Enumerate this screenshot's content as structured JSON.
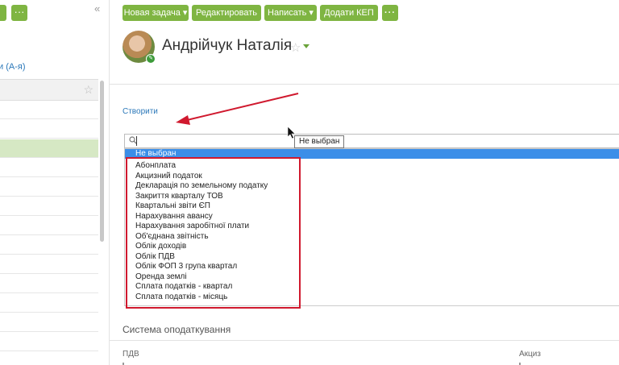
{
  "left_panel": {
    "sort_link": "и (А-я)",
    "collapse_icon": "«"
  },
  "toolbar": {
    "new_task": "Новая задача ▾",
    "edit": "Редактировать",
    "write": "Написать ▾",
    "add_kep": "Додати КЕП",
    "more": "···"
  },
  "contact": {
    "name": "Андрійчук Наталія"
  },
  "create_link": "Створити",
  "tooltip": "Не выбран",
  "dropdown": {
    "selected": "Не выбран",
    "options": [
      "Абонплата",
      "Акцизний податок",
      "Декларація по земельному податку",
      "Закриття кварталу ТОВ",
      "Квартальні звіти ЄП",
      "Нарахування авансу",
      "Нарахування заробітної плати",
      "Об'єднана звітність",
      "Облік доходів",
      "Облік ПДВ",
      "Облік ФОП 3 група квартал",
      "Оренда землі",
      "Сплата податків - квартал",
      "Сплата податків - місяць"
    ]
  },
  "section": {
    "title": "Система оподаткування",
    "field_pdv": "ПДВ",
    "field_excise": "Акциз"
  },
  "icons": {
    "search": "search-icon",
    "star": "star-icon",
    "collapse": "collapse-icon"
  },
  "colors": {
    "accent_green": "#7fb542",
    "link_blue": "#2b78b9",
    "selection_blue": "#3b8ee8",
    "annotation_red": "#d0192e"
  }
}
